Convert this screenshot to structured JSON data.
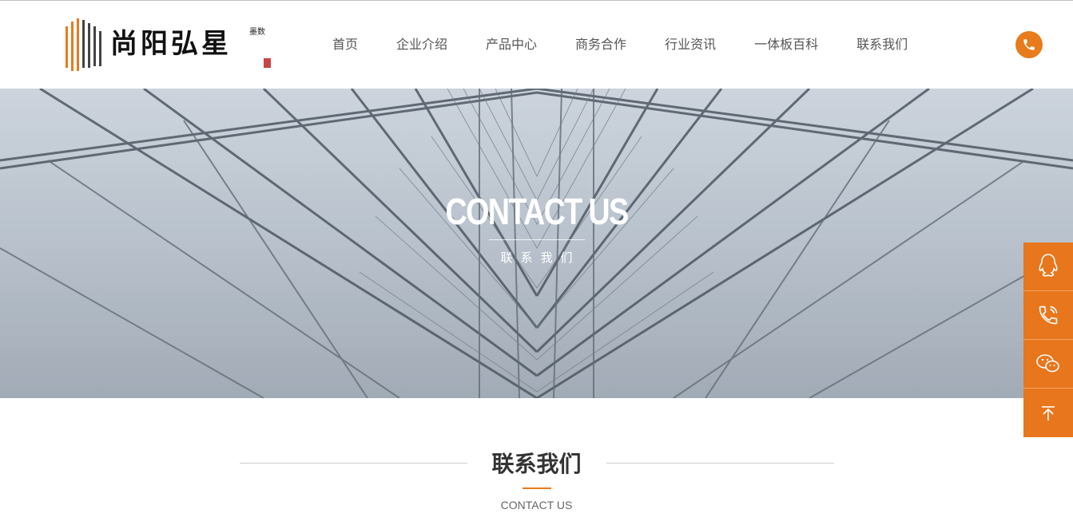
{
  "header": {
    "logo": {
      "text": "尚阳弘星",
      "sub": "墨数"
    },
    "nav": [
      {
        "label": "首页"
      },
      {
        "label": "企业介绍"
      },
      {
        "label": "产品中心"
      },
      {
        "label": "商务合作"
      },
      {
        "label": "行业资讯"
      },
      {
        "label": "一体板百科"
      },
      {
        "label": "联系我们"
      }
    ],
    "phone_icon": "phone-icon"
  },
  "banner": {
    "title": "CONTACT US",
    "subtitle": "联系我们"
  },
  "float_bar": {
    "items": [
      {
        "icon": "qq-icon"
      },
      {
        "icon": "phone-icon"
      },
      {
        "icon": "wechat-icon"
      },
      {
        "icon": "back-to-top-icon"
      }
    ]
  },
  "section": {
    "title": "联系我们",
    "subtitle": "CONTACT US"
  },
  "colors": {
    "accent": "#e87b1c",
    "float_bar": "#e8761c",
    "nav_text": "#555555"
  }
}
